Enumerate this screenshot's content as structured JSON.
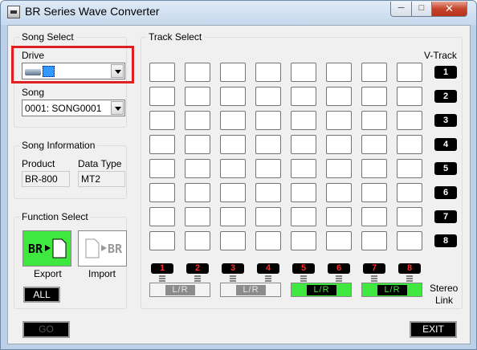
{
  "window": {
    "title": "BR Series Wave Converter",
    "minimize": "─",
    "maximize": "□",
    "close": "✕"
  },
  "song_select": {
    "title": "Song Select",
    "drive_label": "Drive",
    "drive_value": "",
    "drive_icon": "drive-icon",
    "song_label": "Song",
    "song_value": "0001: SONG0001"
  },
  "song_info": {
    "title": "Song Information",
    "product_label": "Product",
    "product_value": "BR-800",
    "data_type_label": "Data Type",
    "data_type_value": "MT2"
  },
  "function_select": {
    "title": "Function Select",
    "export_label": "Export",
    "import_label": "Import",
    "export_icon_text": "BR",
    "import_icon_text": "BR",
    "all_label": "ALL"
  },
  "track_select": {
    "title": "Track Select",
    "vtrack_label": "V-Track",
    "vtracks": [
      "1",
      "2",
      "3",
      "4",
      "5",
      "6",
      "7",
      "8"
    ],
    "tracks": [
      "1",
      "2",
      "3",
      "4",
      "5",
      "6",
      "7",
      "8"
    ],
    "stereo_link_label_1": "Stereo",
    "stereo_link_label_2": "Link",
    "stereo_links": [
      {
        "label": "L/R",
        "active": false
      },
      {
        "label": "L/R",
        "active": false
      },
      {
        "label": "L/R",
        "active": true
      },
      {
        "label": "L/R",
        "active": true
      }
    ]
  },
  "buttons": {
    "go": "GO",
    "exit": "EXIT"
  },
  "colors": {
    "active_green": "#3fe83f",
    "highlight_red": "#e02020",
    "track_number_red": "#ff2a2a"
  }
}
